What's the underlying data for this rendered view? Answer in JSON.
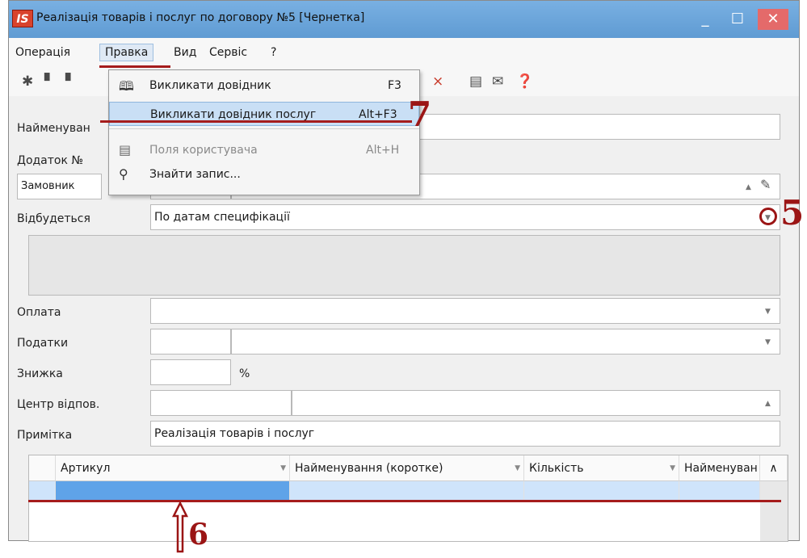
{
  "window": {
    "app_icon": "IS",
    "title": "Реалізація товарів і послуг по договору №5 [Чернетка]",
    "minimize_glyph": "_",
    "maximize_glyph": "☐",
    "close_glyph": "✕"
  },
  "menubar": {
    "items": [
      "Операція",
      "Правка",
      "Вид",
      "Сервіс",
      "?"
    ]
  },
  "toolbar": {
    "icons": [
      "new-doc-icon",
      "user-icon",
      "user-icon",
      "filter-icon",
      "clear-filter-icon",
      "doc-icon",
      "mail-icon",
      "help-icon"
    ]
  },
  "form": {
    "name_label": "Найменуван",
    "addendum_label": "Додаток №",
    "customer_label": "Замовник",
    "occurs_label": "Відбудеться",
    "occurs_value": "По датам специфікації",
    "payment_label": "Оплата",
    "taxes_label": "Податки",
    "discount_label": "Знижка",
    "discount_unit": "%",
    "resp_center_label": "Центр відпов.",
    "note_label": "Примітка",
    "note_value": "Реалізація товарів і послуг"
  },
  "grid": {
    "columns": [
      "Артикул",
      "Найменування (коротке)",
      "Кількість",
      "Найменуван"
    ]
  },
  "dropdown": {
    "items": [
      {
        "label": "Викликати довідник",
        "shortcut": "F3",
        "icon": "book-icon"
      },
      {
        "label": "Викликати довідник послуг",
        "shortcut": "Alt+F3",
        "icon": ""
      },
      {
        "label": "Поля користувача",
        "shortcut": "Alt+H",
        "icon": "form-icon"
      },
      {
        "label": "Знайти запис...",
        "shortcut": "",
        "icon": "search-icon"
      }
    ]
  },
  "annotations": {
    "step5": "5",
    "step6": "6",
    "step7": "7"
  },
  "colors": {
    "titlebar": "#6fa8dc",
    "close_button": "#e46a6a",
    "annotation": "#9b1515",
    "selection": "#c9dff5"
  }
}
